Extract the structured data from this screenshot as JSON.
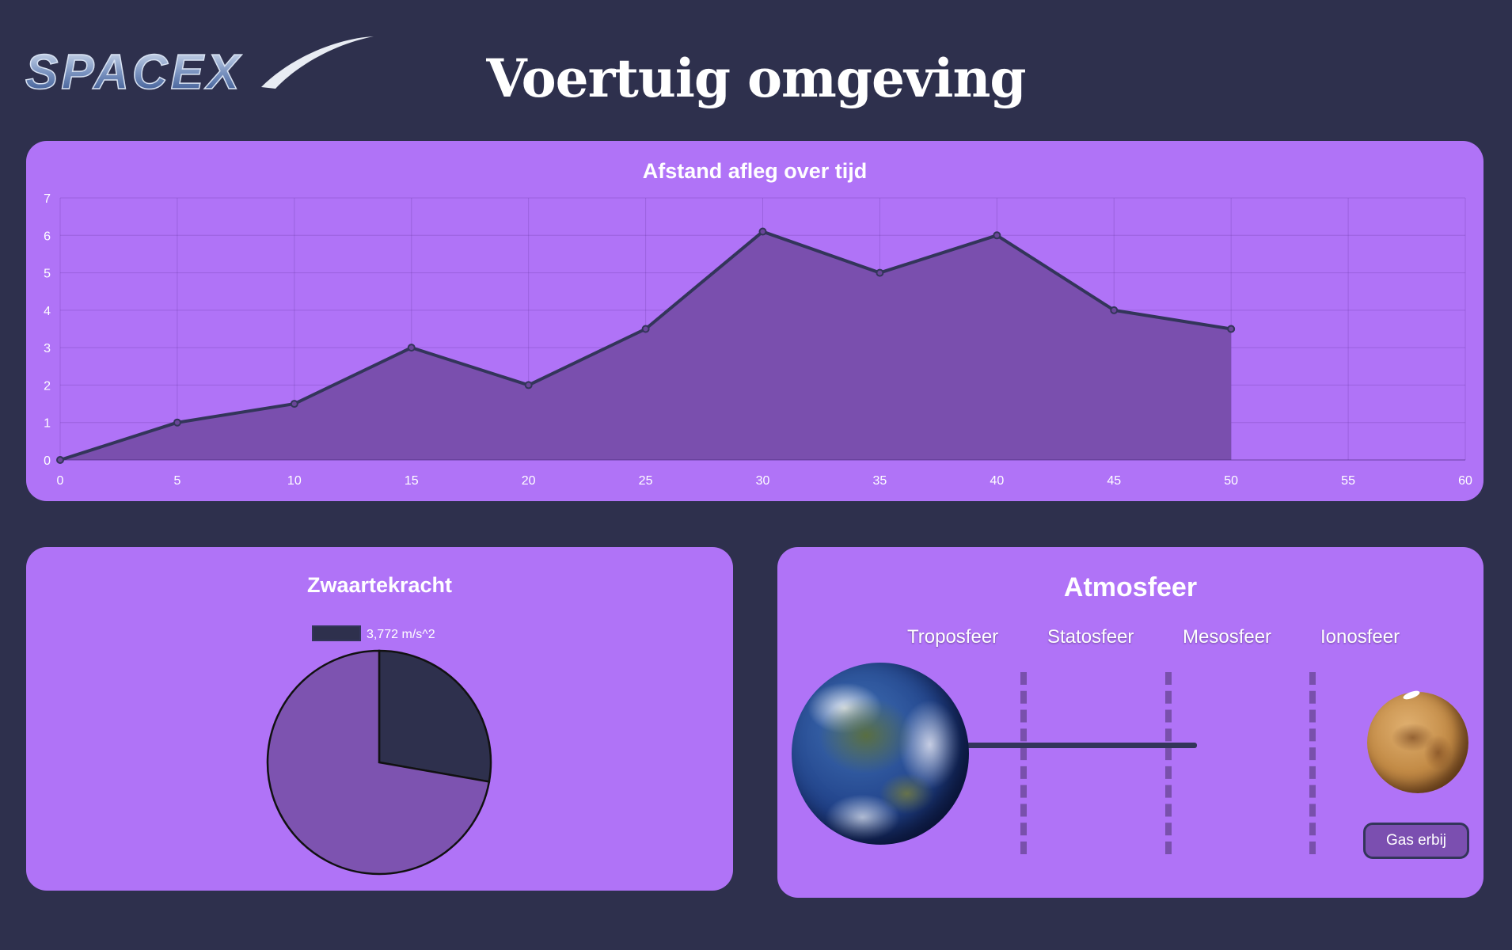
{
  "header": {
    "logo_text": "SPACEX",
    "title": "Voertuig omgeving"
  },
  "line_panel": {
    "title": "Afstand afleg over tijd"
  },
  "gravity_panel": {
    "title": "Zwaartekracht",
    "legend_label": "3,772 m/s^2"
  },
  "atmosphere_panel": {
    "title": "Atmosfeer",
    "layers": [
      "Troposfeer",
      "Statosfeer",
      "Mesosfeer",
      "Ionosfeer"
    ],
    "button_label": "Gas erbij",
    "earth_icon": "earth-icon",
    "mars_icon": "mars-icon",
    "gas_fill_fraction": 0.5
  },
  "colors": {
    "background": "#2e304d",
    "panel": "#b073f7",
    "line": "#33355a",
    "area_fill": "#7a4fae",
    "pie_dark": "#2e304d",
    "pie_light": "#7d53b0"
  },
  "chart_data": [
    {
      "type": "area",
      "title": "Afstand afleg over tijd",
      "x": [
        0,
        5,
        10,
        15,
        20,
        25,
        30,
        35,
        40,
        45,
        50
      ],
      "y": [
        0,
        1,
        1.5,
        3,
        2,
        3.5,
        6.1,
        5,
        6,
        4,
        3.5
      ],
      "xlim": [
        0,
        60
      ],
      "ylim": [
        0,
        7
      ],
      "xticks": [
        0,
        5,
        10,
        15,
        20,
        25,
        30,
        35,
        40,
        45,
        50,
        55,
        60
      ],
      "yticks": [
        0,
        1,
        2,
        3,
        4,
        5,
        6,
        7
      ],
      "grid": true
    },
    {
      "type": "pie",
      "title": "Zwaartekracht",
      "legend": [
        "3,772 m/s^2"
      ],
      "legend_position": "top",
      "values": [
        3.772,
        9.81
      ],
      "colors": [
        "#2e304d",
        "#7d53b0"
      ]
    }
  ]
}
